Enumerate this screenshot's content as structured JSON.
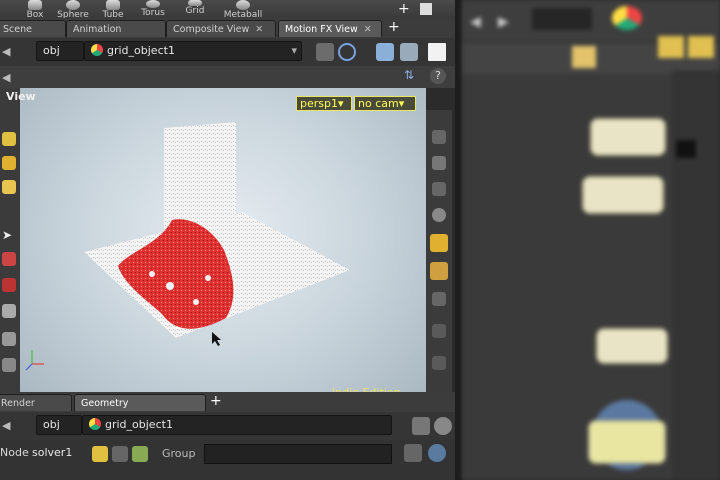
{
  "shelf": {
    "tools": [
      {
        "label": "Box"
      },
      {
        "label": "Sphere"
      },
      {
        "label": "Tube"
      },
      {
        "label": "Torus"
      },
      {
        "label": "Grid"
      },
      {
        "label": "Metaball"
      }
    ]
  },
  "top_tabs": [
    {
      "label": "Scene View"
    },
    {
      "label": "Animation Editor"
    },
    {
      "label": "Composite View"
    },
    {
      "label": "Motion FX View"
    }
  ],
  "viewer_path": {
    "context": "obj",
    "object": "grid_object1"
  },
  "viewport": {
    "title": "View",
    "camera_buttons": [
      {
        "label": "persp1"
      },
      {
        "label": "no cam"
      }
    ],
    "watermark": "Indie Edition",
    "colors": {
      "infected": "#e03030",
      "points": "#f2f2f2"
    }
  },
  "bottom_tabs": [
    {
      "label": "Render View"
    },
    {
      "label": "Geometry Spreadsheet"
    }
  ],
  "bottom_path": {
    "context": "obj",
    "object": "grid_object1"
  },
  "node_bar": {
    "label": "Node",
    "value": "solver1",
    "group_label": "Group"
  }
}
